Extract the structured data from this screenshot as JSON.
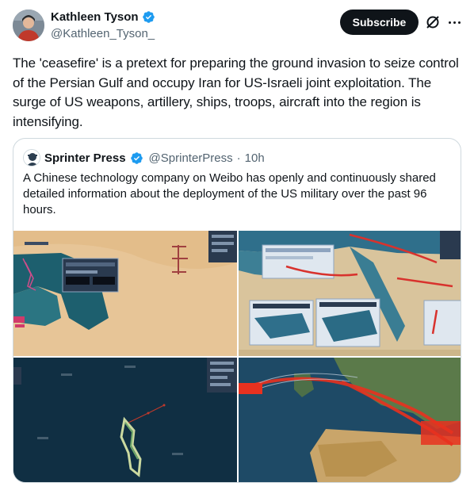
{
  "author": {
    "display_name": "Kathleen Tyson",
    "handle": "@Kathleen_Tyson_",
    "avatar_icon": "profile-photo",
    "verified_icon": "verified-badge-icon",
    "verified_color": "#1d9bf0"
  },
  "actions": {
    "subscribe_label": "Subscribe",
    "grok_icon": "grok-icon",
    "more_icon": "more-icon"
  },
  "tweet": {
    "text": "The 'ceasefire' is a pretext for preparing the ground invasion to seize control of the Persian Gulf and occupy Iran for US-Israeli joint exploitation. The surge of US weapons, artillery, ships, troops, aircraft into the region is intensifying."
  },
  "quote": {
    "display_name": "Sprinter Press",
    "handle": "@SprinterPress",
    "separator": "·",
    "time": "10h",
    "avatar_icon": "sprinter-press-logo",
    "text": "A Chinese technology company on Weibo has openly and continuously shared detailed information about the deployment of the US military over the past 96 hours.",
    "media": [
      {
        "description": "Persian Gulf satellite map with tracking overlay"
      },
      {
        "description": "Middle East map with red flight paths and data panels"
      },
      {
        "description": "Island satellite view with tracking panel"
      },
      {
        "description": "Europe and North Africa map with red flight paths"
      }
    ]
  },
  "colors": {
    "text_primary": "#0f1419",
    "text_secondary": "#536471",
    "border": "#cfd9de",
    "button_bg": "#0f1419",
    "button_text": "#ffffff"
  }
}
